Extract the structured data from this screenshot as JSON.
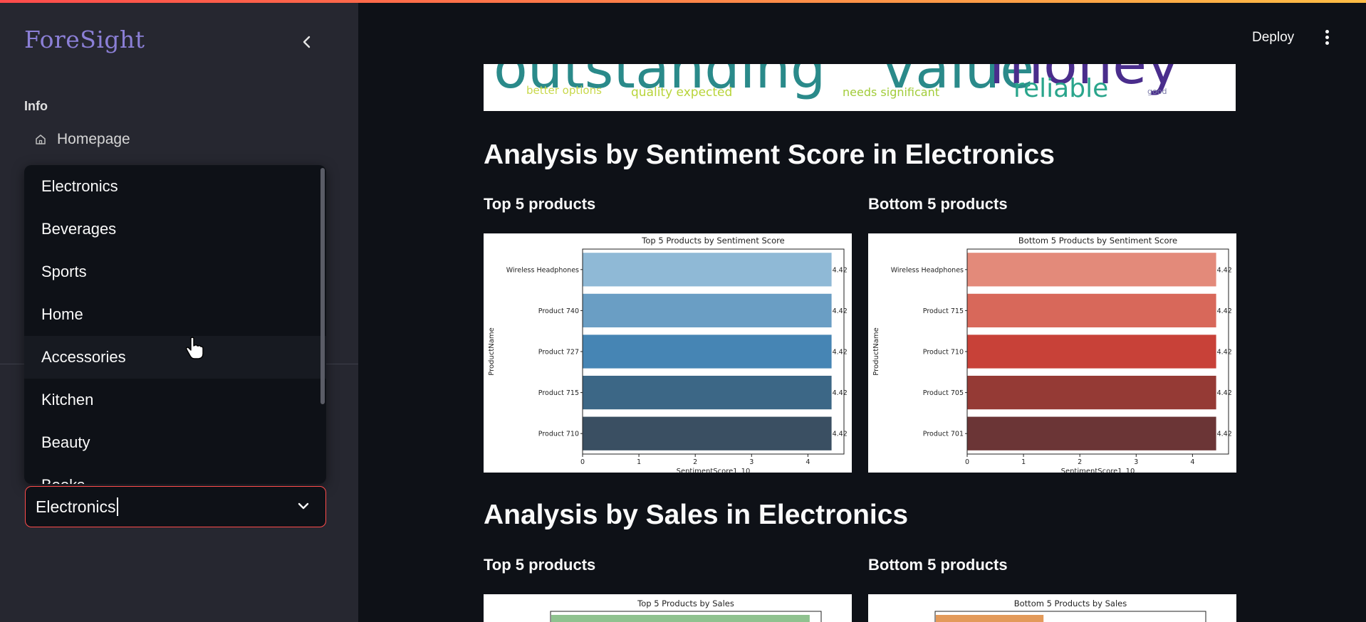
{
  "app": {
    "brand": "ForeSight"
  },
  "sidebar": {
    "section_label": "Info",
    "nav": [
      {
        "label": "Homepage",
        "icon": "home-icon"
      }
    ],
    "dropdown_options": [
      "Electronics",
      "Beverages",
      "Sports",
      "Home",
      "Accessories",
      "Kitchen",
      "Beauty",
      "Books"
    ],
    "select": {
      "value": "Electronics"
    }
  },
  "header": {
    "deploy_label": "Deploy"
  },
  "wordcloud": {
    "words": [
      {
        "text": "outstanding",
        "color": "#2a8a8a"
      },
      {
        "text": "value",
        "color": "#2a8a8a"
      },
      {
        "text": "money",
        "color": "#4a2d8c"
      },
      {
        "text": "reliable",
        "color": "#2aa58c"
      },
      {
        "text": "better options",
        "color": "#c8d84a"
      },
      {
        "text": "quality expected",
        "color": "#b8d43a"
      },
      {
        "text": "needs significant",
        "color": "#a2cc3a"
      },
      {
        "text": "good",
        "color": "#7a7aa8"
      }
    ]
  },
  "sections": [
    {
      "title": "Analysis by Sentiment Score in Electronics",
      "top_label": "Top 5 products",
      "bottom_label": "Bottom 5 products"
    },
    {
      "title": "Analysis by Sales in Electronics",
      "top_label": "Top 5 products",
      "bottom_label": "Bottom 5 products"
    }
  ],
  "chart_data": [
    {
      "type": "bar",
      "orientation": "horizontal",
      "title": "Top 5 Products by Sentiment Score",
      "xlabel": "SentimentScore1_10",
      "ylabel": "ProductName",
      "categories": [
        "Wireless Headphones",
        "Product 740",
        "Product 727",
        "Product 715",
        "Product 710"
      ],
      "values": [
        4.42,
        4.42,
        4.42,
        4.42,
        4.42
      ],
      "value_labels": [
        "4.42",
        "4.42",
        "4.42",
        "4.42",
        "4.42"
      ],
      "xticks": [
        "0",
        "1",
        "2",
        "3",
        "4"
      ],
      "xlim": [
        0,
        4.64
      ],
      "colors": [
        "#8fb9d6",
        "#6a9ec4",
        "#4685b4",
        "#3c6786",
        "#3a4f62"
      ]
    },
    {
      "type": "bar",
      "orientation": "horizontal",
      "title": "Bottom 5 Products by Sentiment Score",
      "xlabel": "SentimentScore1_10",
      "ylabel": "ProductName",
      "categories": [
        "Wireless Headphones",
        "Product 715",
        "Product 710",
        "Product 705",
        "Product 701"
      ],
      "values": [
        4.42,
        4.42,
        4.42,
        4.42,
        4.42
      ],
      "value_labels": [
        "4.42",
        "4.42",
        "4.42",
        "4.42",
        "4.42"
      ],
      "xticks": [
        "0",
        "1",
        "2",
        "3",
        "4"
      ],
      "xlim": [
        0,
        4.64
      ],
      "colors": [
        "#e38a7a",
        "#d8685a",
        "#c84138",
        "#953a35",
        "#6b3536"
      ]
    },
    {
      "type": "bar",
      "orientation": "horizontal",
      "title": "Top 5 Products by Sales",
      "categories": [],
      "values": [],
      "colors": [
        "#8fc28f"
      ]
    },
    {
      "type": "bar",
      "orientation": "horizontal",
      "title": "Bottom 5 Products by Sales",
      "categories": [],
      "values": [],
      "colors": [
        "#e39a5a"
      ]
    }
  ]
}
